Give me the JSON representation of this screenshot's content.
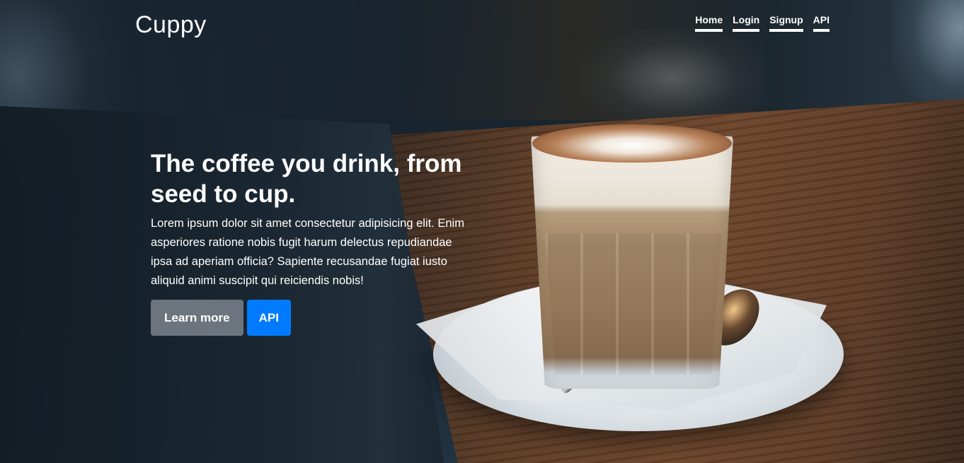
{
  "brand": {
    "name": "Cuppy"
  },
  "nav": {
    "items": [
      {
        "label": "Home"
      },
      {
        "label": "Login"
      },
      {
        "label": "Signup"
      },
      {
        "label": "API"
      }
    ]
  },
  "hero": {
    "headline": "The coffee you drink, from seed to cup.",
    "lead": "Lorem ipsum dolor sit amet consectetur adipisicing elit. Enim asperiores ratione nobis fugit harum delectus repudiandae ipsa ad aperiam officia? Sapiente recusandae fugiat iusto aliquid animi suscipit qui reiciendis nobis!",
    "background_image": "blurred cafe photo: latte in a glass on a saucer with napkin and spoon on a wooden table, laptop in foreground left",
    "buttons": {
      "learn_more": "Learn more",
      "api": "API"
    }
  },
  "colors": {
    "secondary_button": "#6c757d",
    "primary_button": "#007bff",
    "text": "#ffffff"
  }
}
